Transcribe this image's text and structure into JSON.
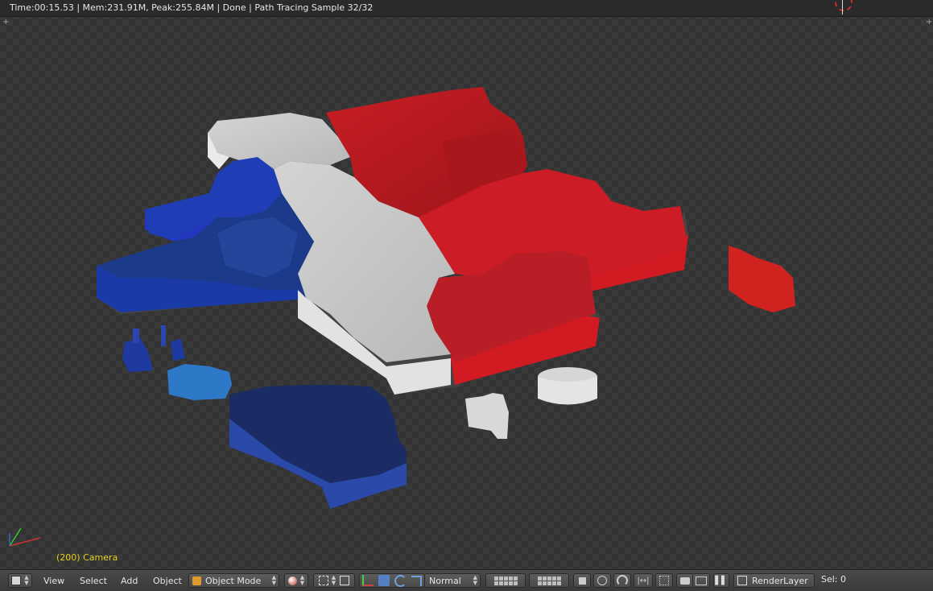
{
  "status": {
    "text": "Time:00:15.53 | Mem:231.91M, Peak:255.84M | Done | Path Tracing Sample 32/32"
  },
  "viewport": {
    "camera_label": "(200) Camera"
  },
  "colors": {
    "red": "#c81e24",
    "white": "#c9c9c9",
    "blue": "#1f3aa0",
    "navy": "#1b2f6b",
    "lightblue": "#2f7fd0",
    "camera_label": "#e6d21a"
  },
  "toolbar": {
    "view": "View",
    "select": "Select",
    "add": "Add",
    "object": "Object",
    "mode": "Object Mode",
    "orientation": "Normal",
    "render_layer": "RenderLayer",
    "sel": "Sel: 0"
  },
  "icons": [
    "editor-type-icon",
    "object-mode-icon",
    "shading-sphere-icon",
    "pivot-icon",
    "manipulator-icon",
    "translate-icon",
    "rotate-icon",
    "scale-icon",
    "layers-icon",
    "lock-icon",
    "proportional-icon",
    "snap-icon",
    "snap-target-icon",
    "render-icon",
    "anim-render-icon",
    "pause-icon",
    "renderlayer-icon"
  ]
}
